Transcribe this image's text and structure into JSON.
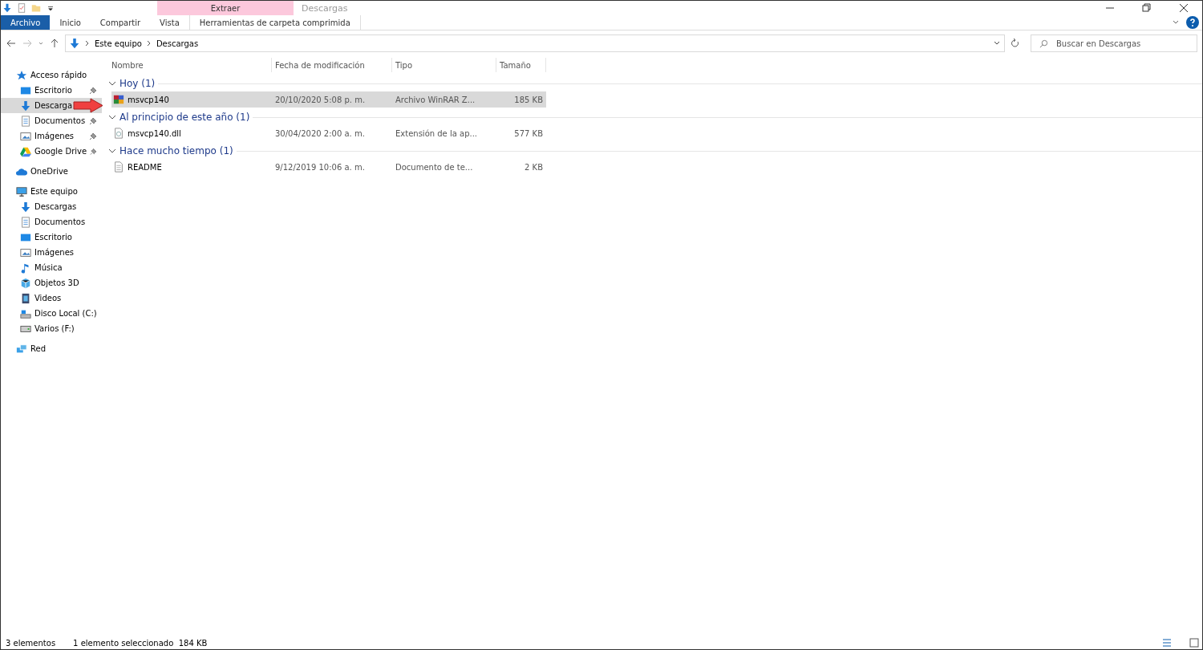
{
  "window": {
    "title": "Descargas",
    "context_tab_group": "Extraer"
  },
  "ribbon_tabs": [
    {
      "label": "Archivo",
      "kind": "file",
      "selected": false
    },
    {
      "label": "Inicio",
      "kind": "tab",
      "selected": false
    },
    {
      "label": "Compartir",
      "kind": "tab",
      "selected": false
    },
    {
      "label": "Vista",
      "kind": "tab",
      "selected": false
    },
    {
      "label": "Herramientas de carpeta comprimida",
      "kind": "context",
      "selected": false
    }
  ],
  "address": {
    "crumbs": [
      "Este equipo",
      "Descargas"
    ]
  },
  "search": {
    "placeholder": "Buscar en Descargas"
  },
  "sidebar": {
    "items": [
      {
        "label": "Acceso rápido",
        "kind": "star",
        "children": [
          {
            "label": "Escritorio",
            "kind": "desktop",
            "pinned": true,
            "selected": false
          },
          {
            "label": "Descarga",
            "kind": "download",
            "pinned": false,
            "selected": true
          },
          {
            "label": "Documentos",
            "kind": "document",
            "pinned": true,
            "selected": false
          },
          {
            "label": "Imágenes",
            "kind": "image",
            "pinned": true,
            "selected": false
          },
          {
            "label": "Google Drive",
            "kind": "drive",
            "pinned": true,
            "selected": false
          }
        ]
      },
      {
        "label": "OneDrive",
        "kind": "cloud"
      },
      {
        "label": "Este equipo",
        "kind": "pc",
        "children": [
          {
            "label": "Descargas",
            "kind": "download",
            "pinned": false,
            "selected": false
          },
          {
            "label": "Documentos",
            "kind": "document",
            "pinned": false,
            "selected": false
          },
          {
            "label": "Escritorio",
            "kind": "desktop",
            "pinned": false,
            "selected": false
          },
          {
            "label": "Imágenes",
            "kind": "image",
            "pinned": false,
            "selected": false
          },
          {
            "label": "Música",
            "kind": "music",
            "pinned": false,
            "selected": false
          },
          {
            "label": "Objetos 3D",
            "kind": "cube",
            "pinned": false,
            "selected": false
          },
          {
            "label": "Videos",
            "kind": "video",
            "pinned": false,
            "selected": false
          },
          {
            "label": "Disco Local (C:)",
            "kind": "disk",
            "pinned": false,
            "selected": false
          },
          {
            "label": "Varios (F:)",
            "kind": "removable",
            "pinned": false,
            "selected": false
          }
        ]
      },
      {
        "label": "Red",
        "kind": "network"
      }
    ]
  },
  "table": {
    "columns": [
      "Nombre",
      "Fecha de modificación",
      "Tipo",
      "Tamaño"
    ],
    "groups": [
      {
        "label": "Hoy (1)",
        "expanded": true,
        "rows": [
          {
            "name": "msvcp140",
            "kind": "archive",
            "date": "20/10/2020 5:08 p. m.",
            "type": "Archivo WinRAR Z...",
            "size": "185 KB",
            "selected": true
          }
        ]
      },
      {
        "label": "Al principio de este año (1)",
        "expanded": true,
        "rows": [
          {
            "name": "msvcp140.dll",
            "kind": "dll",
            "date": "30/04/2020 2:00 a. m.",
            "type": "Extensión de la ap...",
            "size": "577 KB",
            "selected": false
          }
        ]
      },
      {
        "label": "Hace mucho tiempo (1)",
        "expanded": true,
        "rows": [
          {
            "name": "README",
            "kind": "text",
            "date": "9/12/2019 10:06 a. m.",
            "type": "Documento de te...",
            "size": "2 KB",
            "selected": false
          }
        ]
      }
    ]
  },
  "status_bar": {
    "count": "3 elementos",
    "selection": "1 elemento seleccionado  184 KB"
  }
}
